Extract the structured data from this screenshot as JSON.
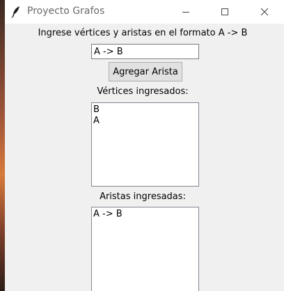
{
  "window": {
    "title": "Proyecto Grafos"
  },
  "form": {
    "instruction": "Ingrese vértices y aristas en el formato A -> B",
    "entry_value": "A -> B",
    "add_button_label": "Agregar Arista"
  },
  "vertices": {
    "label": "Vértices ingresados:",
    "items": [
      "B",
      "A"
    ]
  },
  "aristas": {
    "label": "Aristas ingresadas:",
    "items": [
      "A -> B"
    ]
  }
}
